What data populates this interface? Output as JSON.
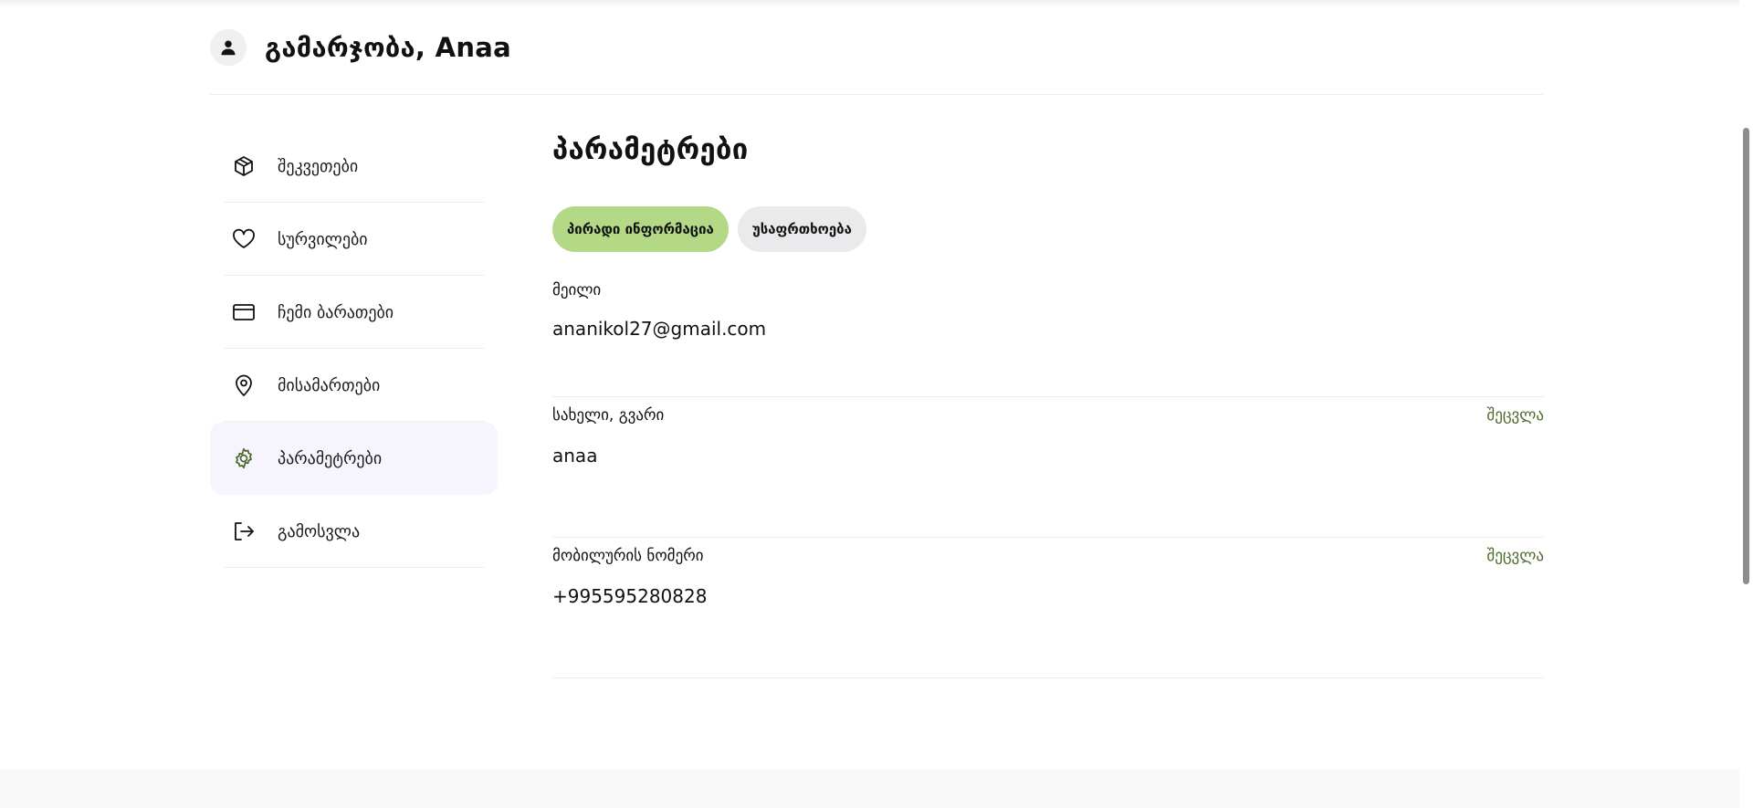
{
  "header": {
    "greeting": "გამარჯობა, Anaa",
    "avatar_icon": "user-icon"
  },
  "sidebar": {
    "items": [
      {
        "label": "შეკვეთები",
        "icon": "package-icon",
        "active": false
      },
      {
        "label": "სურვილები",
        "icon": "heart-icon",
        "active": false
      },
      {
        "label": "ჩემი ბარათები",
        "icon": "credit-card-icon",
        "active": false
      },
      {
        "label": "მისამართები",
        "icon": "map-pin-icon",
        "active": false
      },
      {
        "label": "პარამეტრები",
        "icon": "gear-icon",
        "active": true
      },
      {
        "label": "გამოსვლა",
        "icon": "logout-icon",
        "active": false
      }
    ]
  },
  "main": {
    "title": "პარამეტრები",
    "tabs": [
      {
        "label": "პირადი ინფორმაცია",
        "active": true
      },
      {
        "label": "უსაფრთხოება",
        "active": false
      }
    ],
    "fields": [
      {
        "label": "მეილი",
        "value": "ananikol27@gmail.com",
        "action": ""
      },
      {
        "label": "სახელი, გვარი",
        "value": "anaa",
        "action": "შეცვლა"
      },
      {
        "label": "მობილურის ნომერი",
        "value": "+995595280828",
        "action": "შეცვლა"
      }
    ]
  },
  "colors": {
    "accent_green": "#b3d886",
    "link_green": "#4d6a2a",
    "active_bg": "#f6f4fd"
  }
}
